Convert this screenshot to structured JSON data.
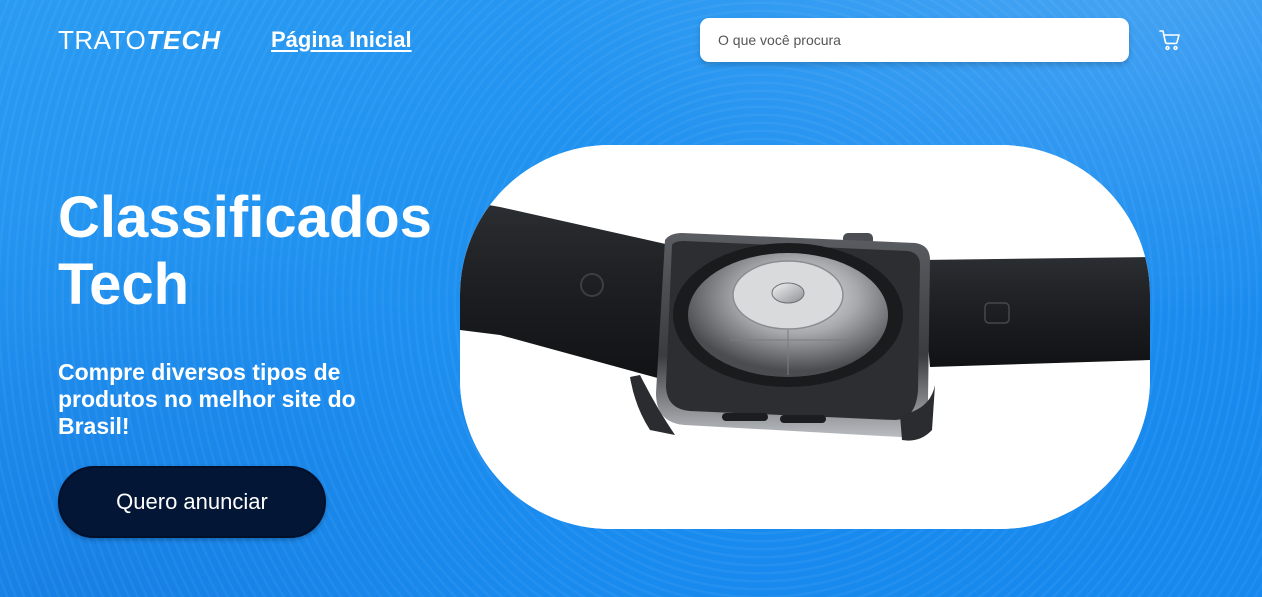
{
  "header": {
    "logo_light": "TRATO",
    "logo_bold": "TECH",
    "nav_home": "Página Inicial",
    "search_placeholder": "O que você procura",
    "search_value": ""
  },
  "hero": {
    "title": "Classificados Tech",
    "subtitle": "Compre diversos tipos de produtos no melhor site do Brasil!",
    "cta_label": "Quero anunciar"
  },
  "icons": {
    "cart": "shopping-cart-icon"
  },
  "colors": {
    "background": "#1d8ff0",
    "cta_background": "#031635",
    "text": "#ffffff"
  }
}
